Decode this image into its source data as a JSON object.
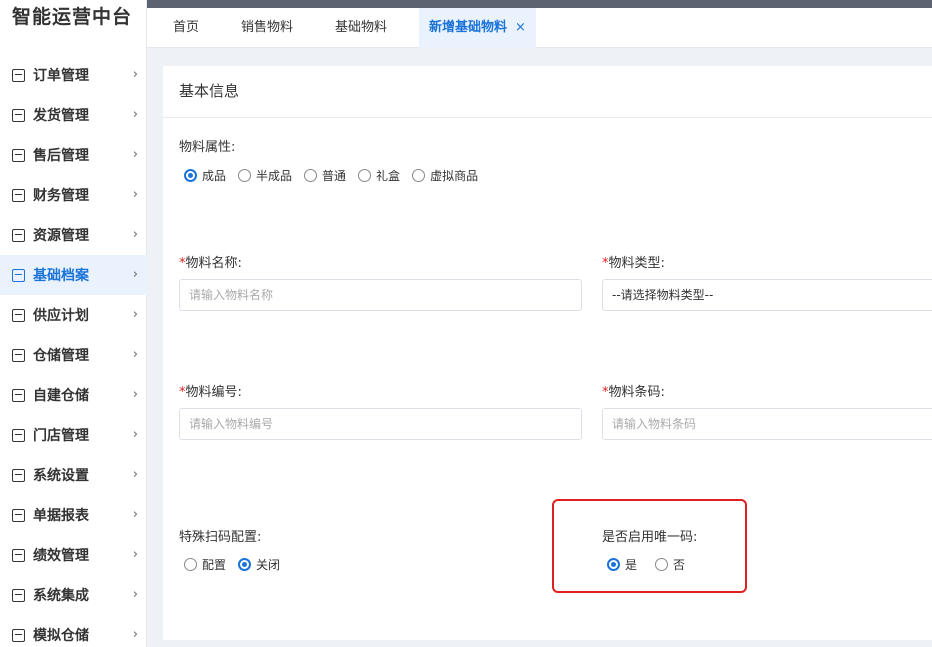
{
  "app": {
    "title": "智能运营中台"
  },
  "sidebar": {
    "items": [
      {
        "label": "订单管理",
        "icon": "document-icon"
      },
      {
        "label": "发货管理",
        "icon": "truck-icon"
      },
      {
        "label": "售后管理",
        "icon": "service-icon"
      },
      {
        "label": "财务管理",
        "icon": "finance-icon"
      },
      {
        "label": "资源管理",
        "icon": "resource-icon"
      },
      {
        "label": "基础档案",
        "icon": "archive-icon",
        "active": true
      },
      {
        "label": "供应计划",
        "icon": "plan-icon"
      },
      {
        "label": "仓储管理",
        "icon": "warehouse-icon"
      },
      {
        "label": "自建仓储",
        "icon": "home-icon"
      },
      {
        "label": "门店管理",
        "icon": "store-icon"
      },
      {
        "label": "系统设置",
        "icon": "settings-icon"
      },
      {
        "label": "单据报表",
        "icon": "report-icon"
      },
      {
        "label": "绩效管理",
        "icon": "performance-icon"
      },
      {
        "label": "系统集成",
        "icon": "integration-icon"
      },
      {
        "label": "模拟仓储",
        "icon": "simulation-icon"
      }
    ],
    "chevron": "›"
  },
  "tabs": [
    {
      "label": "首页"
    },
    {
      "label": "销售物料"
    },
    {
      "label": "基础物料"
    },
    {
      "label": "新增基础物料",
      "active": true,
      "close": "×"
    }
  ],
  "form": {
    "section_title": "基本信息",
    "material_attr": {
      "label": "物料属性:",
      "options": [
        "成品",
        "半成品",
        "普通",
        "礼盒",
        "虚拟商品"
      ],
      "selected": "成品"
    },
    "material_name": {
      "label": "物料名称:",
      "placeholder": "请输入物料名称",
      "required": "*"
    },
    "material_type": {
      "label": "物料类型:",
      "value": "--请选择物料类型--",
      "required": "*"
    },
    "material_code": {
      "label": "物料编号:",
      "placeholder": "请输入物料编号",
      "required": "*"
    },
    "material_barcode": {
      "label": "物料条码:",
      "placeholder": "请输入物料条码",
      "required": "*"
    },
    "special_scan": {
      "label": "特殊扫码配置:",
      "options": [
        "配置",
        "关闭"
      ],
      "selected": "关闭"
    },
    "unique_code": {
      "label": "是否启用唯一码:",
      "options": [
        "是",
        "否"
      ],
      "selected": "是"
    }
  },
  "colors": {
    "accent": "#1a73d9",
    "highlight": "#e02020"
  }
}
